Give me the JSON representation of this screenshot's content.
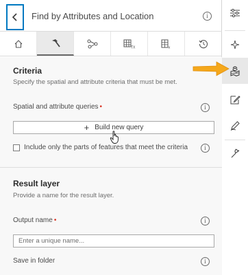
{
  "header": {
    "title": "Find by Attributes and Location",
    "info_glyph": "i"
  },
  "tabs": [
    {
      "name": "home-icon",
      "active": false
    },
    {
      "name": "hammer-icon",
      "active": true
    },
    {
      "name": "network-icon",
      "active": false
    },
    {
      "name": "table-tx-icon",
      "active": false
    },
    {
      "name": "table-x-icon",
      "active": false
    },
    {
      "name": "history-icon",
      "active": false
    }
  ],
  "criteria": {
    "heading": "Criteria",
    "description": "Specify the spatial and attribute criteria that must be met.",
    "queries_label": "Spatial and attribute queries",
    "required_mark": "•",
    "build_button": "Build new query",
    "build_plus": "+",
    "checkbox_label": "Include only the parts of features that meet the criteria",
    "checkbox_checked": false
  },
  "result_layer": {
    "heading": "Result layer",
    "description": "Provide a name for the result layer.",
    "output_label": "Output name",
    "required_mark": "•",
    "output_placeholder": "Enter a unique name...",
    "output_value": "",
    "folder_label": "Save in folder"
  },
  "rail": {
    "items": [
      "sliders-icon",
      "sparkle-icon",
      "map-analysis-icon",
      "edit-icon",
      "pen-icon",
      "wrench-icon"
    ],
    "active": "map-analysis-icon"
  },
  "colors": {
    "accent": "#0079c1",
    "arrow": "#f5a81c",
    "required": "#d83020"
  }
}
